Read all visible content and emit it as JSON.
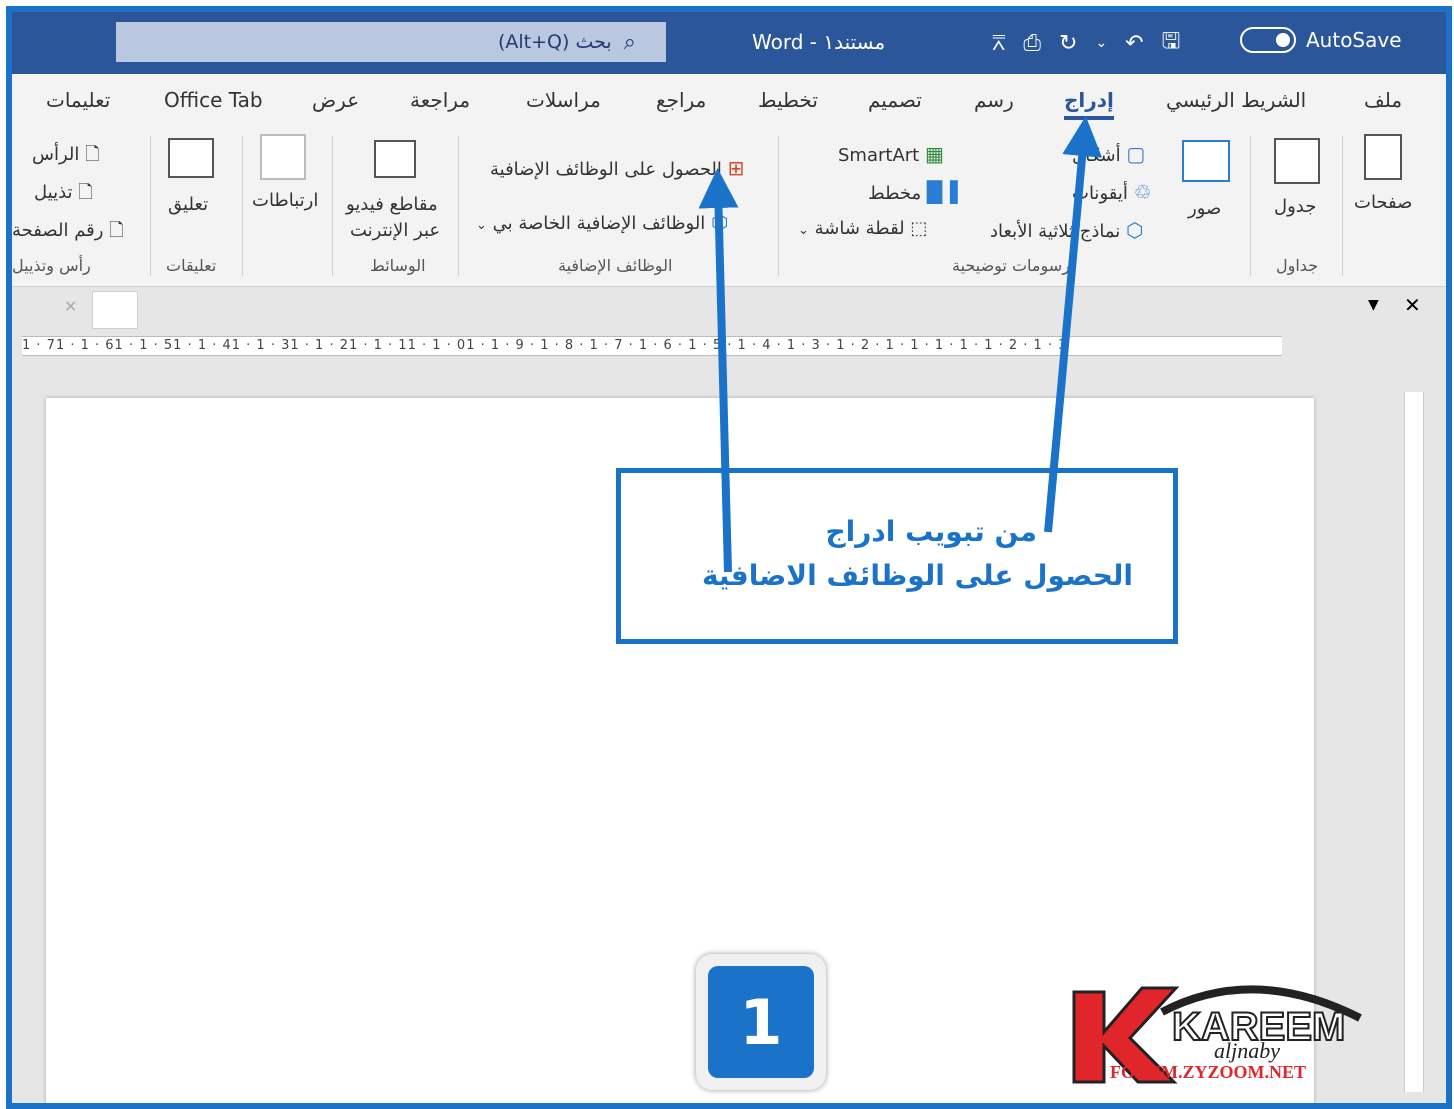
{
  "titlebar": {
    "search_placeholder": "بحث (Alt+Q)",
    "doc_title": "Word - مستند١",
    "autosave_label": "AutoSave"
  },
  "tabs": [
    {
      "id": "file",
      "label": "ملف"
    },
    {
      "id": "home",
      "label": "الشريط الرئيسي"
    },
    {
      "id": "insert",
      "label": "إدراج",
      "active": true
    },
    {
      "id": "draw",
      "label": "رسم"
    },
    {
      "id": "design",
      "label": "تصميم"
    },
    {
      "id": "layout",
      "label": "تخطيط"
    },
    {
      "id": "references",
      "label": "مراجع"
    },
    {
      "id": "mailings",
      "label": "مراسلات"
    },
    {
      "id": "review",
      "label": "مراجعة"
    },
    {
      "id": "view",
      "label": "عرض"
    },
    {
      "id": "officetab",
      "label": "Office Tab"
    },
    {
      "id": "help",
      "label": "تعليمات"
    }
  ],
  "ribbon": {
    "pages_label": "صفحات",
    "table_label": "جدول",
    "pictures_label": "صور",
    "shapes_label": "أشكال",
    "icons_label": "أيقونات",
    "models_label": "نماذج ثلاثية الأبعاد",
    "smartart_label": "SmartArt",
    "chart_label": "مخطط",
    "screenshot_label": "لقطة شاشة",
    "get_addins_label": "الحصول على الوظائف الإضافية",
    "my_addins_label": "الوظائف الإضافية الخاصة بي",
    "online_video_line1": "مقاطع فيديو",
    "online_video_line2": "عبر الإنترنت",
    "links_label": "ارتباطات",
    "comment_label": "تعليق",
    "header_label": "الرأس",
    "footer_label": "تذييل",
    "page_number_label": "رقم الصفحة",
    "groups": {
      "tables": "جداول",
      "illustrations": "رسومات توضيحية",
      "addins": "الوظائف الإضافية",
      "media": "الوسائط",
      "comments": "تعليقات",
      "header_footer": "رأس وتذييل"
    }
  },
  "ruler_text": "1 · 71 · 1 · 61 · 1 · 51 · 1 · 41 · 1 · 31 · 1 · 21 · 1 · 11 · 1 · 01 · 1 · 9 · 1 · 8 · 1 · 7 · 1 · 6 · 1 · 5 · 1 · 4 · 1 · 3 · 1 · 2 · 1 · 1 · 1 · 1 · 1 · 2 · 1 · 3",
  "callout": {
    "line1": "من تبويب ادراج",
    "line2": "الحصول على الوظائف الاضافية"
  },
  "step_number": "1",
  "logo": {
    "brand": "KAREEM",
    "sub": "aljnaby",
    "site": "FORUM.ZYZOOM.NET"
  },
  "colors": {
    "word_blue": "#2b579a",
    "annotation_blue": "#1a73c9",
    "logo_red": "#e0262b"
  }
}
